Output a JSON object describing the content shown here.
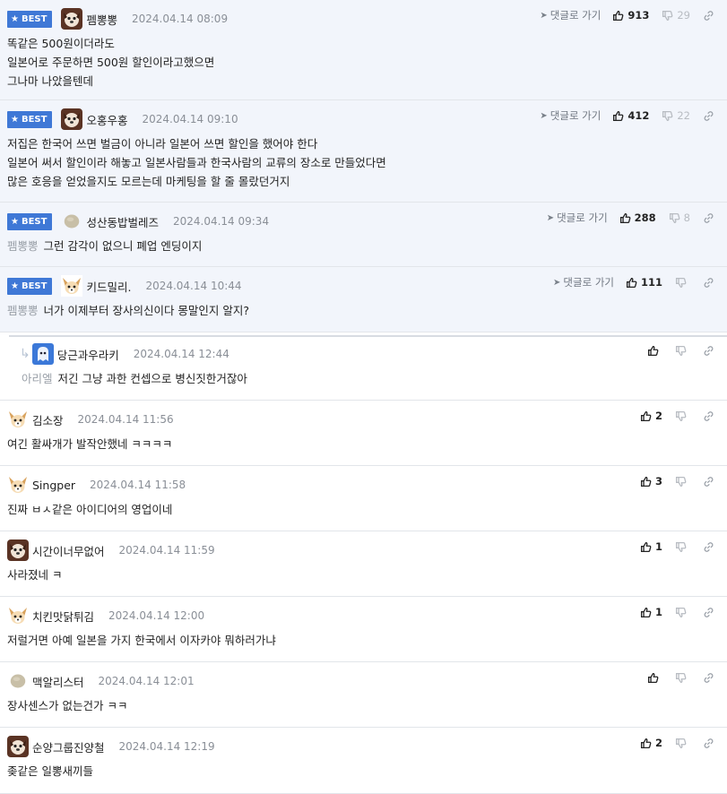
{
  "ui": {
    "best_label": "BEST",
    "reply_label": "댓글로 가기"
  },
  "comments": [
    {
      "best": true,
      "nick": "펨뽕뽕",
      "date": "2024.04.14 08:09",
      "avatar": "dog-face",
      "up": "913",
      "down": "29",
      "lines": [
        "똑같은 500원이더라도",
        "일본어로 주문하면 500원 할인이라고했으면",
        "그나마 나았을텐데"
      ],
      "mention": ""
    },
    {
      "best": true,
      "nick": "오홍우홍",
      "date": "2024.04.14 09:10",
      "avatar": "dog-face",
      "up": "412",
      "down": "22",
      "lines": [
        "저집은 한국어 쓰면 벌금이 아니라 일본어 쓰면 할인을 했어야 한다",
        "일본어 써서 할인이라 해놓고 일본사람들과 한국사람의 교류의 장소로 만들었다면",
        "많은 호응을 얻었을지도 모르는데 마케팅을 할 줄 몰랐던거지"
      ],
      "mention": ""
    },
    {
      "best": true,
      "nick": "성산동밥벌레즈",
      "date": "2024.04.14 09:34",
      "avatar": "pebble",
      "up": "288",
      "down": "8",
      "lines": [
        "그런 감각이 없으니 폐업 엔딩이지"
      ],
      "mention": "펨뽕뽕"
    },
    {
      "best": true,
      "nick": "키드밀리.",
      "date": "2024.04.14 10:44",
      "avatar": "chihuahua",
      "up": "111",
      "down": "",
      "lines": [
        "너가 이제부터 장사의신이다 몽말인지 알지?"
      ],
      "mention": "펨뽕뽕"
    },
    {
      "best": false,
      "reply": true,
      "nick": "당근과우라키",
      "date": "2024.04.14 12:44",
      "avatar": "ghost",
      "up": "",
      "down": "",
      "lines": [
        "저긴 그냥 과한 컨셉으로 병신짓한거잖아"
      ],
      "mention": "아리엘"
    },
    {
      "best": false,
      "nick": "김소장",
      "date": "2024.04.14 11:56",
      "avatar": "chihuahua",
      "up": "2",
      "down": "",
      "lines": [
        "여긴 활싸개가 발작안했네 ㅋㅋㅋㅋ"
      ],
      "mention": ""
    },
    {
      "best": false,
      "nick": "Singper",
      "date": "2024.04.14 11:58",
      "avatar": "chihuahua",
      "up": "3",
      "down": "",
      "lines": [
        "진짜 ㅂㅅ같은 아이디어의 영업이네"
      ],
      "mention": ""
    },
    {
      "best": false,
      "nick": "시간이너무없어",
      "date": "2024.04.14 11:59",
      "avatar": "dog-face",
      "up": "1",
      "down": "",
      "lines": [
        "사라졌네 ㅋ"
      ],
      "mention": ""
    },
    {
      "best": false,
      "nick": "치킨맛닭튀김",
      "date": "2024.04.14 12:00",
      "avatar": "chihuahua",
      "up": "1",
      "down": "",
      "lines": [
        "저럴거면 아예 일본을 가지 한국에서 이자카야 뭐하러가냐"
      ],
      "mention": ""
    },
    {
      "best": false,
      "nick": "맥알리스터",
      "date": "2024.04.14 12:01",
      "avatar": "pebble",
      "up": "",
      "down": "",
      "lines": [
        "장사센스가 없는건가 ㅋㅋ"
      ],
      "mention": ""
    },
    {
      "best": false,
      "nick": "순양그룹진양철",
      "date": "2024.04.14 12:19",
      "avatar": "dog-face",
      "up": "2",
      "down": "",
      "lines": [
        "좆같은 일뽕새끼들"
      ],
      "mention": ""
    }
  ],
  "colors": {
    "best_badge": "#3f78d6",
    "best_bg": "#f2f5fb",
    "date_text": "#8a8f97",
    "mention_text": "#9aa0a8"
  }
}
